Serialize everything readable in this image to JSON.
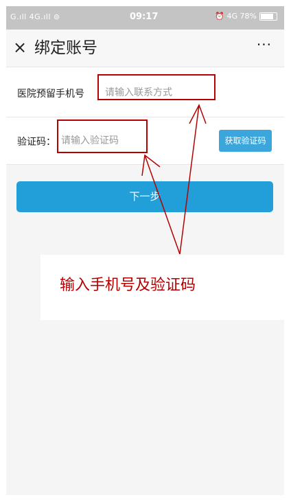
{
  "status_bar": {
    "signal_left": "G.ıll 4G.ıll ⊚",
    "time": "09:17",
    "right": "⏰ 4G 78%"
  },
  "nav": {
    "close_glyph": "×",
    "title": "绑定账号",
    "more_glyph": "···"
  },
  "form": {
    "phone_label": "医院预留手机号",
    "phone_placeholder": "请输入联系方式",
    "code_label": "验证码：",
    "code_placeholder": "请输入验证码",
    "get_code_button": "获取验证码"
  },
  "next_button": "下一步",
  "annotation": {
    "text": "输入手机号及验证码",
    "color": "#b30000"
  },
  "colors": {
    "primary": "#229ed9",
    "status_bar": "#c4c4c4"
  }
}
